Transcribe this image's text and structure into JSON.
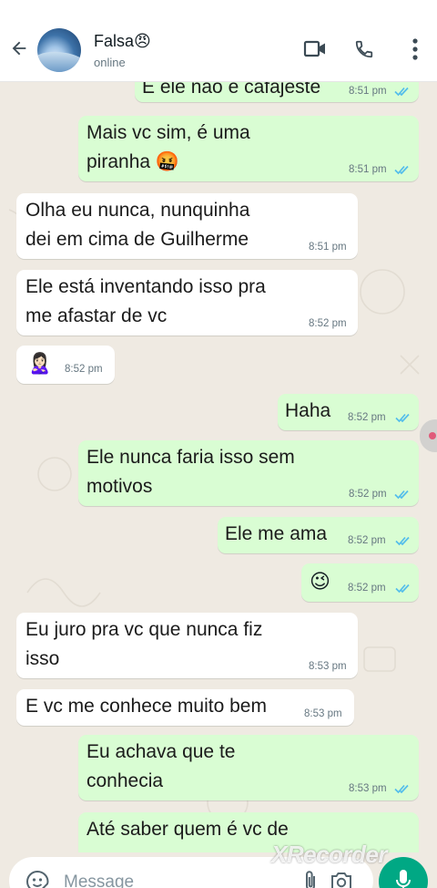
{
  "header": {
    "contact_name": "Falsa😠",
    "status": "online"
  },
  "messages": [
    {
      "dir": "out",
      "text": "É ele não é cafajeste",
      "time": "8:51 pm"
    },
    {
      "dir": "out",
      "lines": [
        "Mais vc sim, é uma",
        "piranha 🤬"
      ],
      "time": "8:51 pm"
    },
    {
      "dir": "in",
      "lines": [
        "Olha eu nunca, nunquinha",
        "dei em cima de Guilherme"
      ],
      "time": "8:51 pm"
    },
    {
      "dir": "in",
      "lines": [
        "Ele está inventando isso pra",
        "me afastar de vc"
      ],
      "time": "8:52 pm"
    },
    {
      "dir": "in",
      "emoji": "🙎🏻‍♀️",
      "time": "8:52 pm"
    },
    {
      "dir": "out",
      "text": "Haha",
      "time": "8:52 pm"
    },
    {
      "dir": "out",
      "lines": [
        "Ele nunca faria isso sem",
        "motivos"
      ],
      "time": "8:52 pm"
    },
    {
      "dir": "out",
      "text": "Ele me ama",
      "time": "8:52 pm"
    },
    {
      "dir": "out",
      "emoji": "😉",
      "time": "8:52 pm"
    },
    {
      "dir": "in",
      "lines": [
        "Eu juro pra vc que nunca fiz",
        "isso"
      ],
      "time": "8:53 pm"
    },
    {
      "dir": "in",
      "text": "E vc me conhece muito bem",
      "time": "8:53 pm"
    },
    {
      "dir": "out",
      "lines": [
        "Eu achava que te",
        "conhecia"
      ],
      "time": "8:53 pm"
    },
    {
      "dir": "out",
      "text": "Até saber quem é vc de",
      "time": ""
    }
  ],
  "footer": {
    "placeholder": "Message",
    "icons": [
      "sticker-icon",
      "attach-icon",
      "camera-icon",
      "mic-icon"
    ]
  },
  "watermark": "XRecorder",
  "colors": {
    "outgoing_bubble": "#d9fdd3",
    "incoming_bubble": "#ffffff",
    "read_ticks": "#53bdeb",
    "accent": "#00a884"
  }
}
